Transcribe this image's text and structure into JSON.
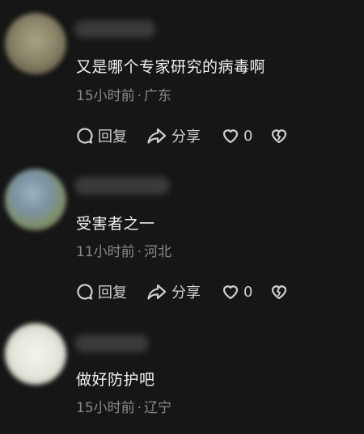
{
  "comments": [
    {
      "text": "又是哪个专家研究的病毒啊",
      "time": "15小时前",
      "location": "广东",
      "reply_label": "回复",
      "share_label": "分享",
      "like_count": "0"
    },
    {
      "text": "受害者之一",
      "time": "11小时前",
      "location": "河北",
      "reply_label": "回复",
      "share_label": "分享",
      "like_count": "0"
    },
    {
      "text": "做好防护吧",
      "time": "15小时前",
      "location": "辽宁"
    }
  ],
  "separator": "·",
  "icons": {
    "reply": "reply-bubble-icon",
    "share": "share-arrow-icon",
    "like": "heart-icon",
    "dislike": "broken-heart-icon"
  },
  "colors": {
    "background": "#161616",
    "text": "#f0f0f0",
    "meta": "#8a8a8a",
    "action": "#cfcfcf"
  }
}
